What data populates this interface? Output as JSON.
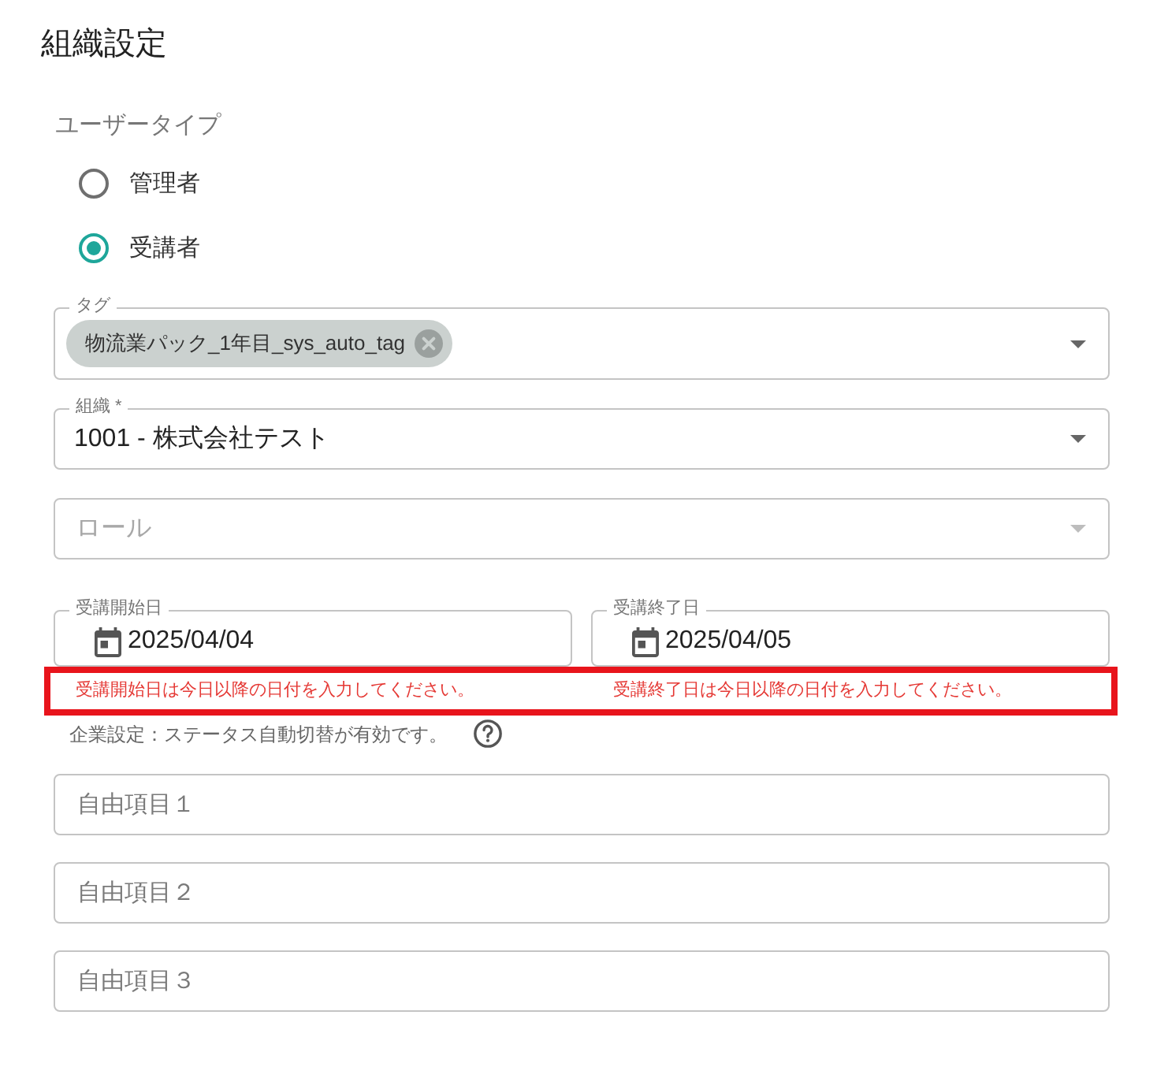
{
  "title": "組織設定",
  "user_type": {
    "label": "ユーザータイプ",
    "options": [
      {
        "label": "管理者",
        "selected": false
      },
      {
        "label": "受講者",
        "selected": true
      }
    ]
  },
  "tag_field": {
    "label": "タグ",
    "chips": [
      {
        "label": "物流業パック_1年目_sys_auto_tag"
      }
    ]
  },
  "organization_field": {
    "label": "組織 *",
    "value": "1001 - 株式会社テスト"
  },
  "role_field": {
    "placeholder": "ロール",
    "disabled": true
  },
  "date_fields": [
    {
      "label": "受講開始日",
      "value": "2025/04/04",
      "error": "受講開始日は今日以降の日付を入力してください。"
    },
    {
      "label": "受講終了日",
      "value": "2025/04/05",
      "error": "受講終了日は今日以降の日付を入力してください。"
    }
  ],
  "status_note": "企業設定：ステータス自動切替が有効です。",
  "free_fields": [
    {
      "placeholder": "自由項目１"
    },
    {
      "placeholder": "自由項目２"
    },
    {
      "placeholder": "自由項目３"
    }
  ]
}
